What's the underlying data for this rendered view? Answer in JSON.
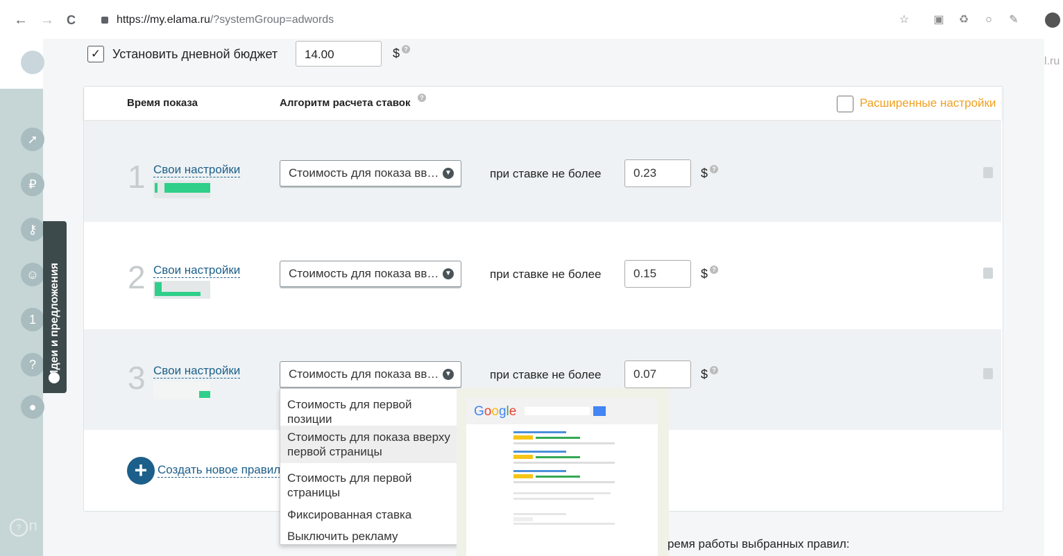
{
  "browser": {
    "url_host": "https://my.elama.ru",
    "url_rest": "/?systemGroup=adwords",
    "back_icon": "←",
    "forward_icon": "→",
    "reload_icon": "C"
  },
  "sidebar": {
    "ideas_label": "Идеи и предложения",
    "right_text": "l.ru",
    "bottom_label": "П"
  },
  "budget": {
    "checked": true,
    "label": "Установить дневной бюджет",
    "value": "14.00",
    "currency": "$"
  },
  "table": {
    "col_time": "Время показа",
    "col_algo": "Алгоритм расчета ставок",
    "advanced_label": "Расширенные настройки",
    "rows": [
      {
        "num": "1",
        "own_label": "Свои настройки",
        "select_value": "Стоимость для показа вв…",
        "bid_text": "при ставке не более",
        "bid_value": "0.23",
        "currency": "$"
      },
      {
        "num": "2",
        "own_label": "Свои настройки",
        "select_value": "Стоимость для показа вв…",
        "bid_text": "при ставке не более",
        "bid_value": "0.15",
        "currency": "$"
      },
      {
        "num": "3",
        "own_label": "Свои настройки",
        "select_value": "Стоимость для показа вв…",
        "bid_text": "при ставке не более",
        "bid_value": "0.07",
        "currency": "$"
      }
    ],
    "create_rule_label": "Создать новое правило"
  },
  "dropdown": {
    "options": [
      "Стоимость для первой позиции",
      "Стоимость для показа вверху первой страницы",
      "Стоимость для первой страницы",
      "Фиксированная ставка",
      "Выключить рекламу"
    ],
    "selected_index": 1
  },
  "preview": {
    "brand": "Google"
  },
  "footer_text": "ремя работы выбранных правил:"
}
